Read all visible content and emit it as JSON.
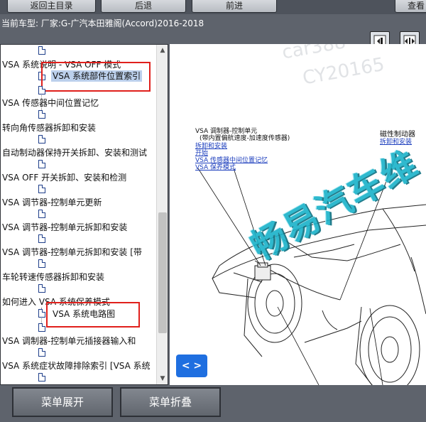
{
  "toolbar": {
    "btn1_label": "返回主目录",
    "btn2_label": "后退",
    "btn3_label": "前进",
    "btn4_label": "查看"
  },
  "header": {
    "model_label": "当前车型:   厂家:G-广汽本田雅阁(Accord)2016-2018"
  },
  "tree": {
    "items": [
      {
        "label": "VSA 系统说明 - VSA OFF 模式"
      },
      {
        "label": "VSA 传感器中间位置记忆"
      },
      {
        "label": "转向角传感器拆卸和安装"
      },
      {
        "label": "自动制动器保持开关拆卸、安装和测试"
      },
      {
        "label": "VSA OFF 开关拆卸、安装和检测"
      },
      {
        "label": "VSA 调节器-控制单元更新"
      },
      {
        "label": "VSA 调节器-控制单元拆卸和安装"
      },
      {
        "label": "VSA 调节器-控制单元拆卸和安装 [带"
      },
      {
        "label": "车轮转速传感器拆卸和安装"
      },
      {
        "label": "如何进入 VSA 系统保养模式"
      },
      {
        "label": "VSA 调制器-控制单元插接器输入和"
      },
      {
        "label": "VSA 系统症状故障排除索引 [VSA 系统"
      }
    ],
    "leaf_parts": "VSA 系统部件位置索引",
    "leaf_circuit": "VSA 系统电路图"
  },
  "diagram": {
    "watermark_url": "car388",
    "watermark_id": "CY20165",
    "watermark_brand": "畅易汽车维",
    "title": "VSA 调制器-控制单元",
    "subtitle": "(带内置偏航速度-加速度传感器)",
    "links": [
      "拆卸和安装",
      "开始",
      "VSA 传感器中间位置记忆",
      "VSA 保养模式"
    ],
    "right_title": "磁性制动器",
    "right_link": "拆卸和安装",
    "nav_label": "< >"
  },
  "bottom": {
    "expand_label": "菜单展开",
    "collapse_label": "菜单折叠"
  },
  "colors": {
    "highlight_box": "#e0201c",
    "selection": "#bcd0ec",
    "link": "#1b3dbd",
    "watermark_brand": "#19b2c9",
    "nav_button": "#1f6fe0"
  }
}
